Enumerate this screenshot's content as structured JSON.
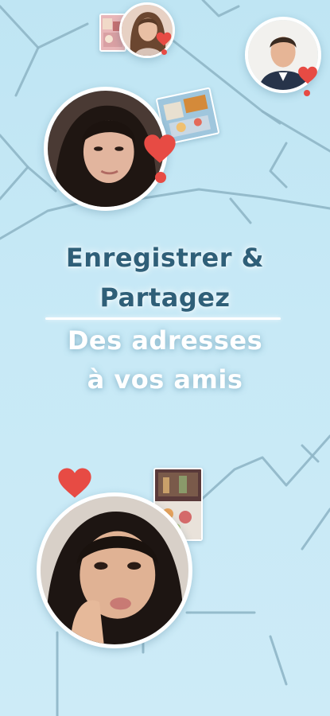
{
  "headline": {
    "line1": "Enregistrer &",
    "line2": "Partagez"
  },
  "subheadline": {
    "line1": "Des adresses",
    "line2": "à vos amis"
  },
  "colors": {
    "background": "#c4e7f5",
    "map_lines": "#8fb6c6",
    "headline": "#2f5f78",
    "subheadline": "#ffffff",
    "heart": "#e74b44"
  },
  "icons": [
    "heart-icon"
  ]
}
